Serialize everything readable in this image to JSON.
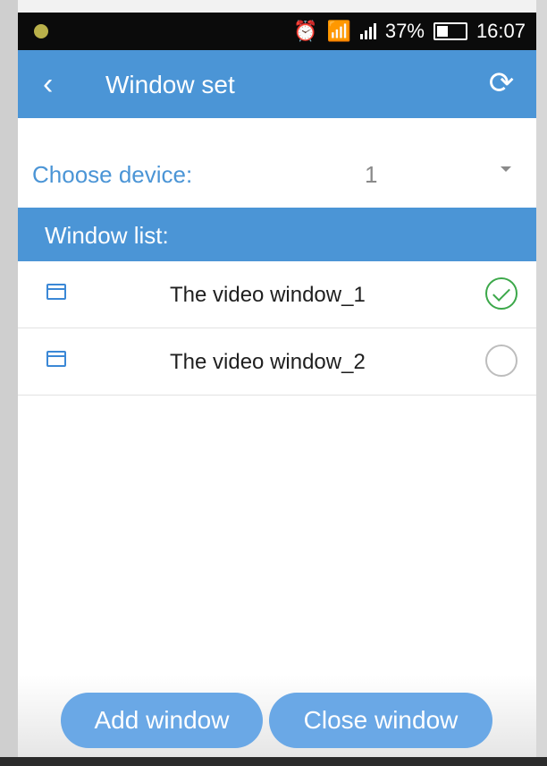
{
  "statusbar": {
    "battery_percent": "37%",
    "time": "16:07"
  },
  "appbar": {
    "title": "Window set",
    "back_icon": "chevron-left-icon",
    "refresh_icon": "refresh-icon"
  },
  "device": {
    "label": "Choose device:",
    "value": "1"
  },
  "list": {
    "header": "Window list:",
    "items": [
      {
        "label": "The video window_1",
        "selected": true
      },
      {
        "label": "The video window_2",
        "selected": false
      }
    ]
  },
  "actions": {
    "add": "Add window",
    "close": "Close window"
  },
  "colors": {
    "accent": "#4b95d6",
    "check": "#3ca84a"
  }
}
